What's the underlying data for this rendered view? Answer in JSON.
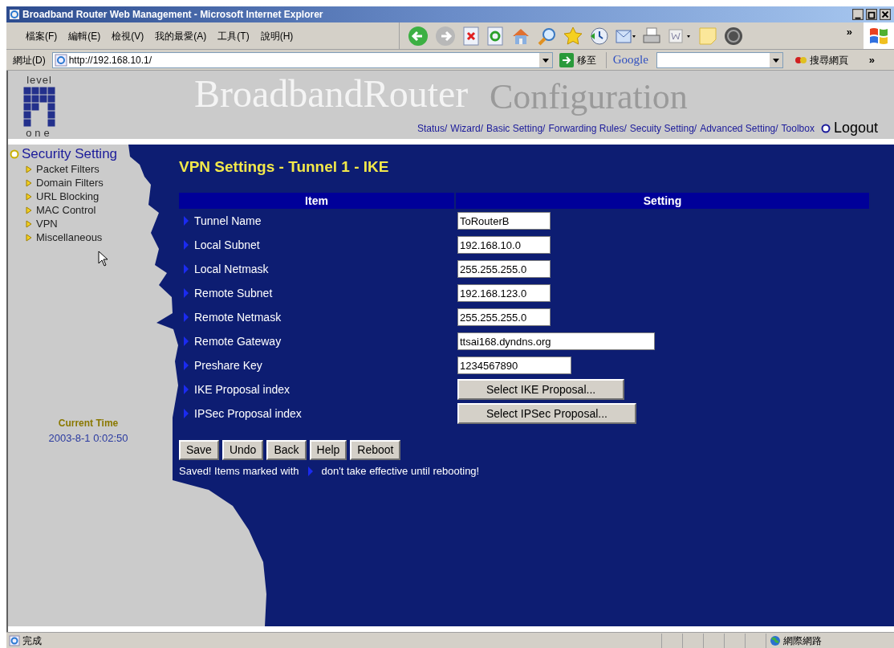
{
  "window": {
    "title": "Broadband Router Web Management - Microsoft Internet Explorer"
  },
  "menu": [
    "檔案(F)",
    "編輯(E)",
    "檢視(V)",
    "我的最愛(A)",
    "工具(T)",
    "說明(H)"
  ],
  "toolbar_more": "»",
  "address_bar": {
    "label": "網址(D)",
    "url": "http://192.168.10.1/",
    "go": "移至"
  },
  "google_toolbar": {
    "label": "Google",
    "search_button": "搜尋網頁",
    "more": "»"
  },
  "header": {
    "logo_top": "level",
    "logo_bottom": "one",
    "title": "BroadbandRouter",
    "subtitle": "Configuration",
    "nav": [
      "Status/",
      "Wizard/",
      "Basic Setting/",
      "Forwarding Rules/",
      "Secuity Setting/",
      "Advanced Setting/",
      "Toolbox"
    ],
    "logout": "Logout"
  },
  "sidebar": {
    "section": "Security Setting",
    "items": [
      "Packet Filters",
      "Domain Filters",
      "URL Blocking",
      "MAC Control",
      "VPN",
      "Miscellaneous"
    ],
    "time_label": "Current Time",
    "time_value": "2003-8-1 0:02:50"
  },
  "main": {
    "title": "VPN Settings - Tunnel 1 - IKE",
    "columns": [
      "Item",
      "Setting"
    ],
    "rows": [
      {
        "label": "Tunnel Name",
        "kind": "input",
        "value": "ToRouterB"
      },
      {
        "label": "Local Subnet",
        "kind": "input",
        "value": "192.168.10.0"
      },
      {
        "label": "Local Netmask",
        "kind": "input",
        "value": "255.255.255.0"
      },
      {
        "label": "Remote Subnet",
        "kind": "input",
        "value": "192.168.123.0"
      },
      {
        "label": "Remote Netmask",
        "kind": "input",
        "value": "255.255.255.0"
      },
      {
        "label": "Remote Gateway",
        "kind": "input",
        "value": "ttsai168.dyndns.org"
      },
      {
        "label": "Preshare Key",
        "kind": "input",
        "value": "1234567890"
      },
      {
        "label": "IKE Proposal index",
        "kind": "button",
        "value": "Select IKE Proposal..."
      },
      {
        "label": "IPSec Proposal index",
        "kind": "button",
        "value": "Select IPSec Proposal..."
      }
    ],
    "buttons": [
      "Save",
      "Undo",
      "Back",
      "Help",
      "Reboot"
    ],
    "note_before": "Saved! Items marked with",
    "note_after": "don't take effective until rebooting!"
  },
  "status_bar": {
    "text": "完成",
    "zone": "網際網路"
  }
}
